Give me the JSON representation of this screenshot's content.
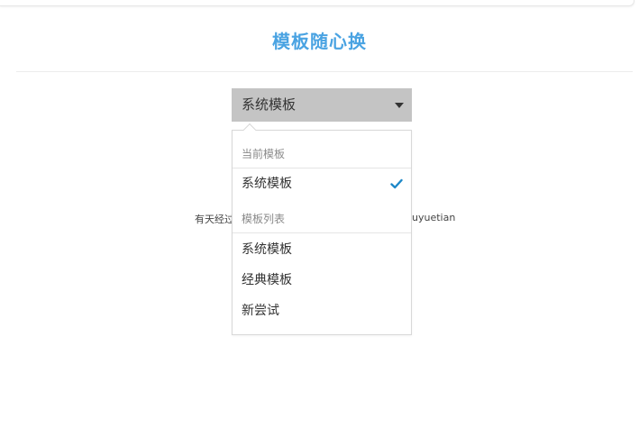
{
  "page": {
    "title": "模板随心换",
    "caption_left": "有天经过",
    "caption_right": "uyuetian"
  },
  "select": {
    "value": "系统模板",
    "icon": "caret-down-icon"
  },
  "dropdown": {
    "current_header": "当前模板",
    "current_item": "系统模板",
    "check_icon": "check-icon",
    "list_header": "模板列表",
    "list_items": [
      "系统模板",
      "经典模板",
      "新尝试"
    ]
  },
  "colors": {
    "title": "#4aa3e2",
    "select_bg": "#c4c4c4",
    "check": "#1e88c8"
  }
}
